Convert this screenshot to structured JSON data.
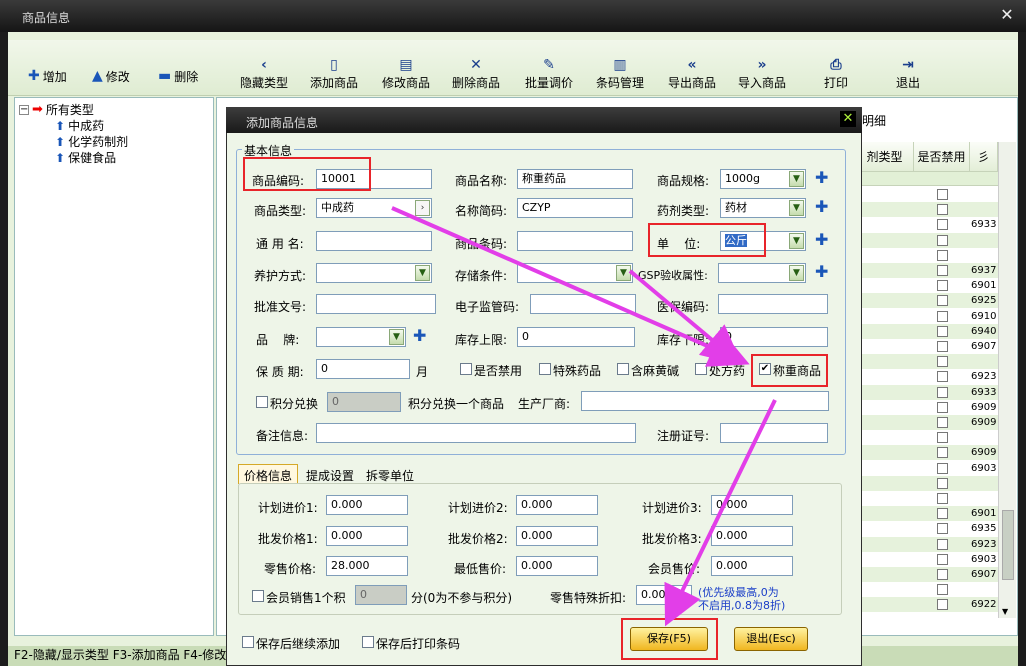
{
  "window": {
    "title": "商品信息"
  },
  "toolbar_left": [
    {
      "label": "增加",
      "icon": "plus"
    },
    {
      "label": "修改",
      "icon": "triangle-up"
    },
    {
      "label": "删除",
      "icon": "minus"
    }
  ],
  "toolbar": [
    {
      "label": "隐藏类型"
    },
    {
      "label": "添加商品"
    },
    {
      "label": "修改商品"
    },
    {
      "label": "删除商品"
    },
    {
      "label": "批量调价"
    },
    {
      "label": "条码管理"
    },
    {
      "label": "导出商品"
    },
    {
      "label": "导入商品"
    },
    {
      "label": "打印"
    },
    {
      "label": "退出"
    }
  ],
  "tree": {
    "root": "所有类型",
    "children": [
      "中成药",
      "化学药制剂",
      "保健食品"
    ]
  },
  "grid": {
    "partial_header": "明细",
    "col_dosage": "剂类型",
    "col_disabled": "是否禁用",
    "col_cut": "彡",
    "barcodes": [
      "",
      "",
      "6933",
      "",
      "",
      "6937",
      "6901",
      "6925",
      "6910",
      "6940",
      "6907",
      "",
      "6923",
      "6933",
      "6909",
      "6909",
      "",
      "6909",
      "6903",
      "",
      "",
      "6901",
      "6935",
      "6923",
      "6903",
      "6907",
      "",
      "6922"
    ]
  },
  "status_bar": "F2-隐藏/显示类型  F3-添加商品  F4-修改",
  "dialog": {
    "title": "添加商品信息",
    "basic_legend": "基本信息",
    "fields": {
      "code": {
        "label": "商品编码:",
        "value": "10001"
      },
      "name": {
        "label": "商品名称:",
        "value": "称重药品"
      },
      "spec": {
        "label": "商品规格:",
        "value": "1000g"
      },
      "type": {
        "label": "商品类型:",
        "value": "中成药"
      },
      "short": {
        "label": "名称简码:",
        "value": "CZYP"
      },
      "dosage": {
        "label": "药剂类型:",
        "value": "药材"
      },
      "common": {
        "label": "通 用 名:",
        "value": ""
      },
      "barcode": {
        "label": "商品条码:",
        "value": ""
      },
      "unit": {
        "label": "单    位:",
        "value": "公斤"
      },
      "care": {
        "label": "养护方式:",
        "value": ""
      },
      "storage": {
        "label": "存储条件:",
        "value": ""
      },
      "gsp": {
        "label": "GSP验收属性:",
        "value": ""
      },
      "approval": {
        "label": "批准文号:",
        "value": ""
      },
      "supervise": {
        "label": "电子监管码:",
        "value": ""
      },
      "medins": {
        "label": "医保编码:",
        "value": ""
      },
      "brand": {
        "label": "品    牌:",
        "value": ""
      },
      "upper": {
        "label": "库存上限:",
        "value": "0"
      },
      "lower": {
        "label": "库存下限:",
        "value": "0"
      },
      "shelf": {
        "label": "保 质 期:",
        "value": "0",
        "unit": "月"
      },
      "points_val": {
        "value": "0"
      },
      "maker": {
        "label": "生产厂商:",
        "value": ""
      },
      "remark": {
        "label": "备注信息:",
        "value": ""
      },
      "regno": {
        "label": "注册证号:",
        "value": ""
      }
    },
    "checks": {
      "disabled": {
        "label": "是否禁用",
        "checked": false
      },
      "special": {
        "label": "特殊药品",
        "checked": false
      },
      "ephedrine": {
        "label": "含麻黄碱",
        "checked": false
      },
      "rx": {
        "label": "处方药",
        "checked": false
      },
      "weighed": {
        "label": "称重商品",
        "checked": true
      },
      "points": {
        "label": "积分兑换",
        "checked": false
      },
      "points_text": "积分兑换一个商品"
    },
    "tabs": [
      "价格信息",
      "提成设置",
      "拆零单位"
    ],
    "prices": {
      "plan1": {
        "label": "计划进价1:",
        "value": "0.000"
      },
      "plan2": {
        "label": "计划进价2:",
        "value": "0.000"
      },
      "plan3": {
        "label": "计划进价3:",
        "value": "0.000"
      },
      "whole1": {
        "label": "批发价格1:",
        "value": "0.000"
      },
      "whole2": {
        "label": "批发价格2:",
        "value": "0.000"
      },
      "whole3": {
        "label": "批发价格3:",
        "value": "0.000"
      },
      "retail": {
        "label": "零售价格:",
        "value": "28.000"
      },
      "lowest": {
        "label": "最低售价:",
        "value": "0.000"
      },
      "member": {
        "label": "会员售价:",
        "value": "0.000"
      },
      "member_points_label": "会员销售1个积",
      "member_points_value": "0",
      "member_points_note": "分(0为不参与积分)",
      "discount": {
        "label": "零售特殊折扣:",
        "value": "0.00"
      },
      "discount_note1": "(优先级最高,0为",
      "discount_note2": "不启用,0.8为8折)"
    },
    "footer": {
      "continue_add": "保存后继续添加",
      "print_barcode": "保存后打印条码",
      "save": "保存(F5)",
      "exit": "退出(Esc)"
    }
  },
  "colors": {
    "annotation": "#e8242a",
    "arrow": "#e23ee8"
  }
}
